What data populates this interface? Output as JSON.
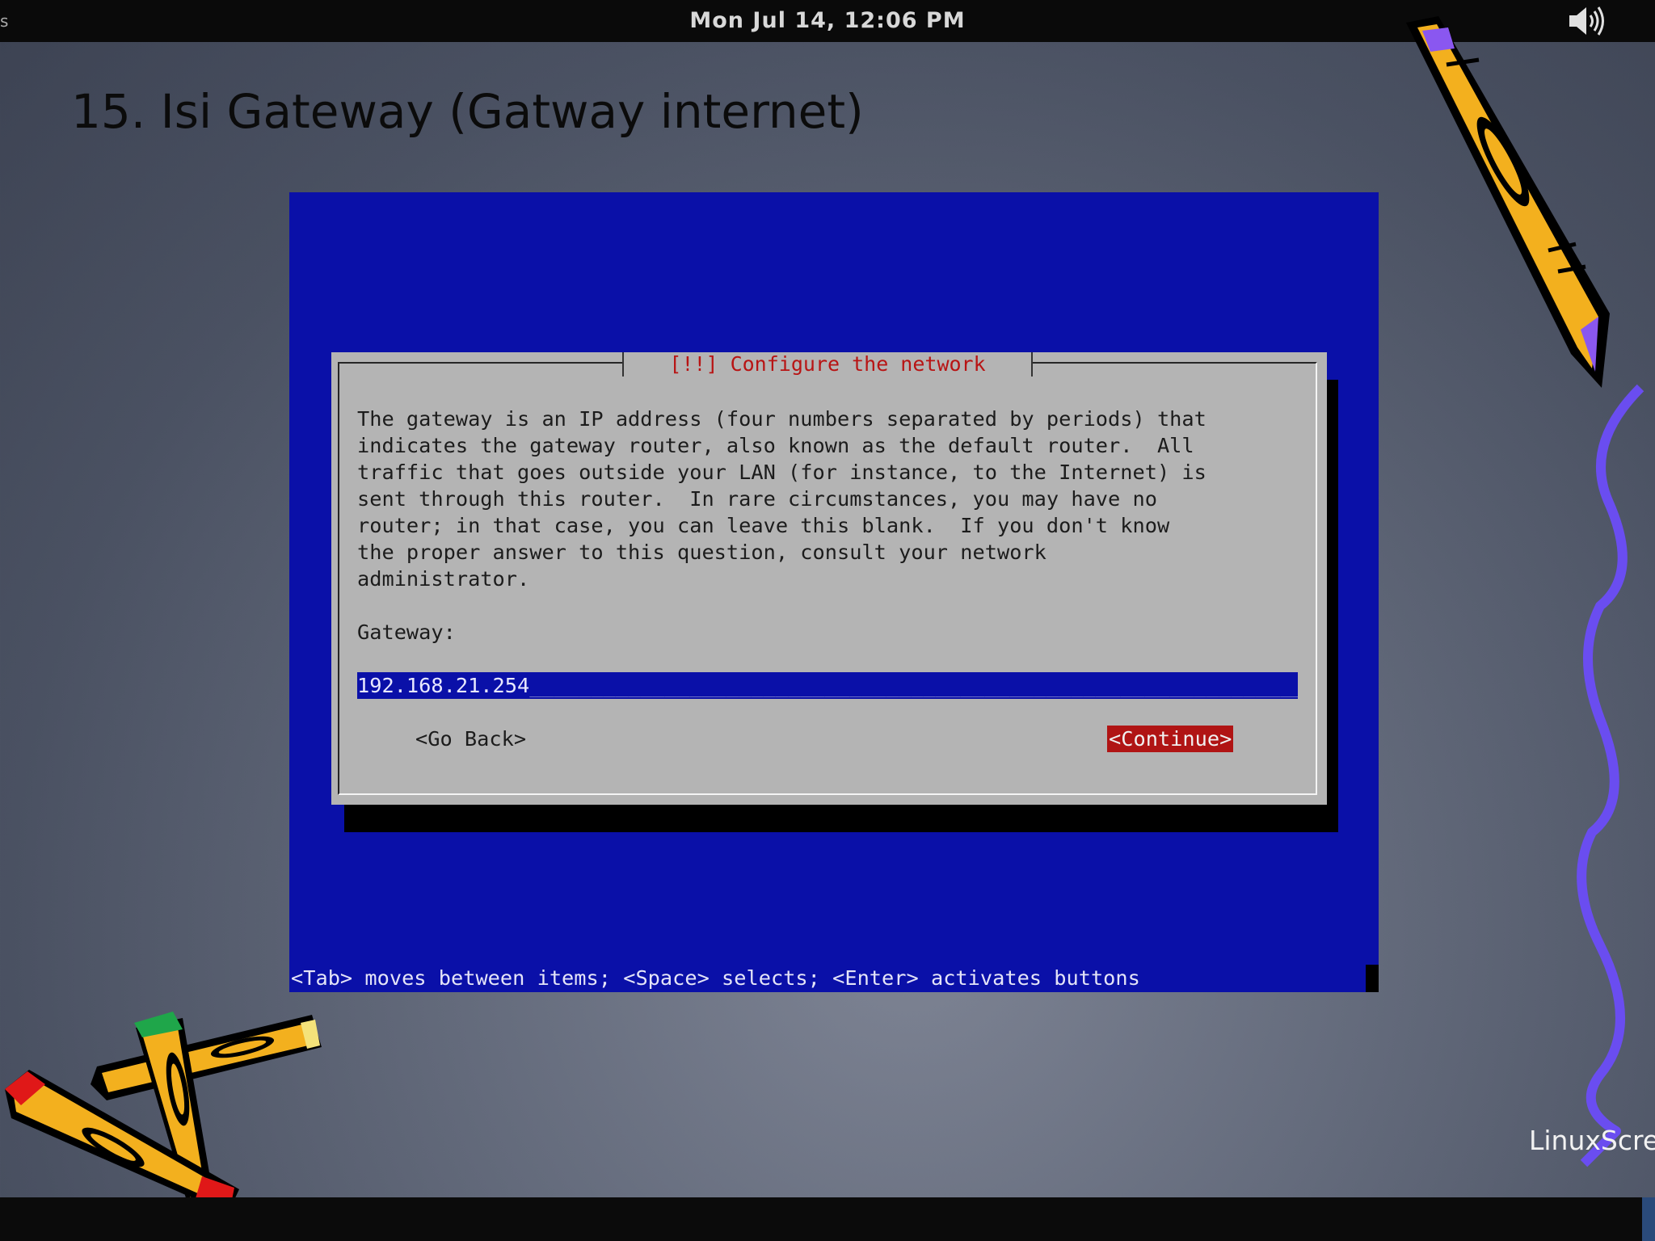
{
  "topbar": {
    "clock": "Mon Jul 14, 12:06 PM",
    "left_glyph": "s",
    "volume_icon": "speaker-volume-icon"
  },
  "slide": {
    "title": "15. Isi Gateway (Gatway internet)"
  },
  "installer": {
    "dialog_title": "[!!] Configure the network",
    "body_lines": [
      "The gateway is an IP address (four numbers separated by periods) that",
      "indicates the gateway router, also known as the default router.  All",
      "traffic that goes outside your LAN (for instance, to the Internet) is",
      "sent through this router.  In rare circumstances, you may have no",
      "router; in that case, you can leave this blank.  If you don't know",
      "the proper answer to this question, consult your network",
      "administrator."
    ],
    "field_label": "Gateway:",
    "field_value": "192.168.21.254",
    "go_back_button": "<Go Back>",
    "continue_button": "<Continue>",
    "help_line": "<Tab> moves between items; <Space> selects; <Enter> activates buttons"
  },
  "watermark": "LinuxScre",
  "colors": {
    "installer_background": "#0a10a8",
    "dialog_background": "#b4b4b4",
    "accent_red": "#b01414",
    "desktop_background": "#646b7c"
  }
}
